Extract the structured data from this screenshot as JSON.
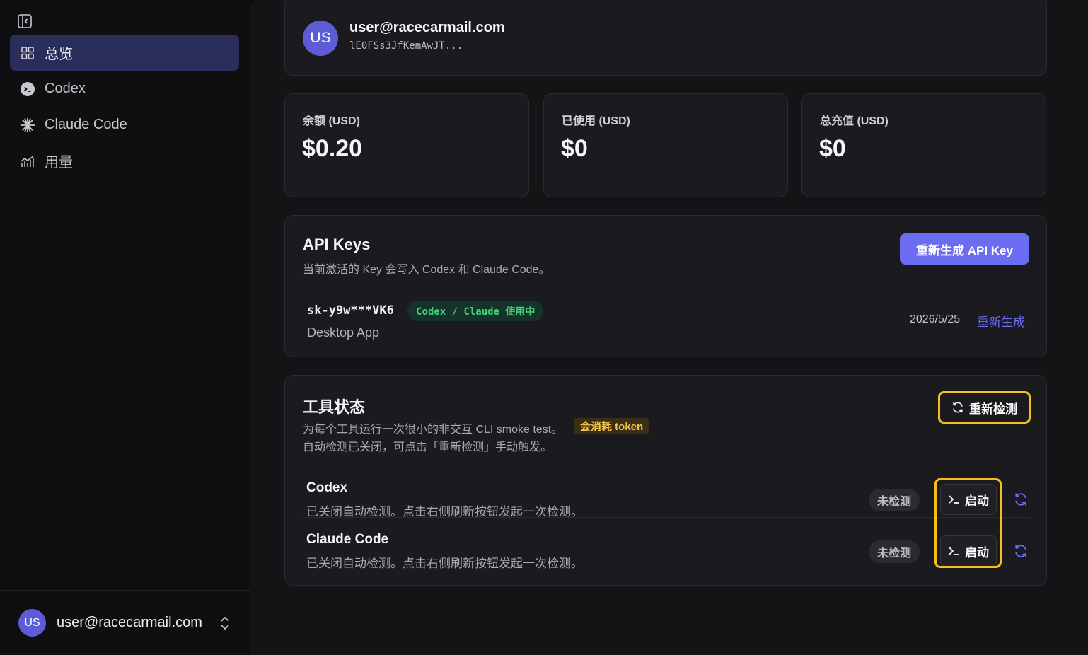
{
  "sidebar": {
    "items": [
      {
        "label": "总览",
        "icon": "grid-icon",
        "active": true
      },
      {
        "label": "Codex",
        "icon": "codex-icon"
      },
      {
        "label": "Claude Code",
        "icon": "claude-icon"
      },
      {
        "label": "用量",
        "icon": "chart-icon"
      }
    ],
    "account": {
      "initials": "US",
      "email": "user@racecarmail.com"
    }
  },
  "profile": {
    "initials": "US",
    "email": "user@racecarmail.com",
    "id": "lE0FSs3JfKemAwJT..."
  },
  "stats": [
    {
      "label": "余额 (USD)",
      "value": "$0.20"
    },
    {
      "label": "已使用 (USD)",
      "value": "$0"
    },
    {
      "label": "总充值 (USD)",
      "value": "$0"
    }
  ],
  "api_keys": {
    "title": "API Keys",
    "description": "当前激活的 Key 会写入 Codex 和 Claude Code。",
    "regenerate_button": "重新生成 API Key",
    "key": {
      "name": "sk-y9w***VK6",
      "badge": "Codex / Claude 使用中",
      "app": "Desktop App",
      "date": "2026/5/25",
      "regenerate_link": "重新生成"
    }
  },
  "tools": {
    "title": "工具状态",
    "description": "为每个工具运行一次很小的非交互 CLI smoke test。",
    "token_badge": "会消耗 token",
    "description2": "自动检测已关闭，可点击「重新检测」手动触发。",
    "recheck_button": "重新检测",
    "rows": [
      {
        "name": "Codex",
        "desc": "已关闭自动检测。点击右侧刷新按钮发起一次检测。",
        "status": "未检测",
        "launch": "启动"
      },
      {
        "name": "Claude Code",
        "desc": "已关闭自动检测。点击右侧刷新按钮发起一次检测。",
        "status": "未检测",
        "launch": "启动"
      }
    ]
  },
  "colors": {
    "accent": "#6b6cf2",
    "highlight": "#f4bf1a",
    "active_badge": "#3fd07a"
  }
}
